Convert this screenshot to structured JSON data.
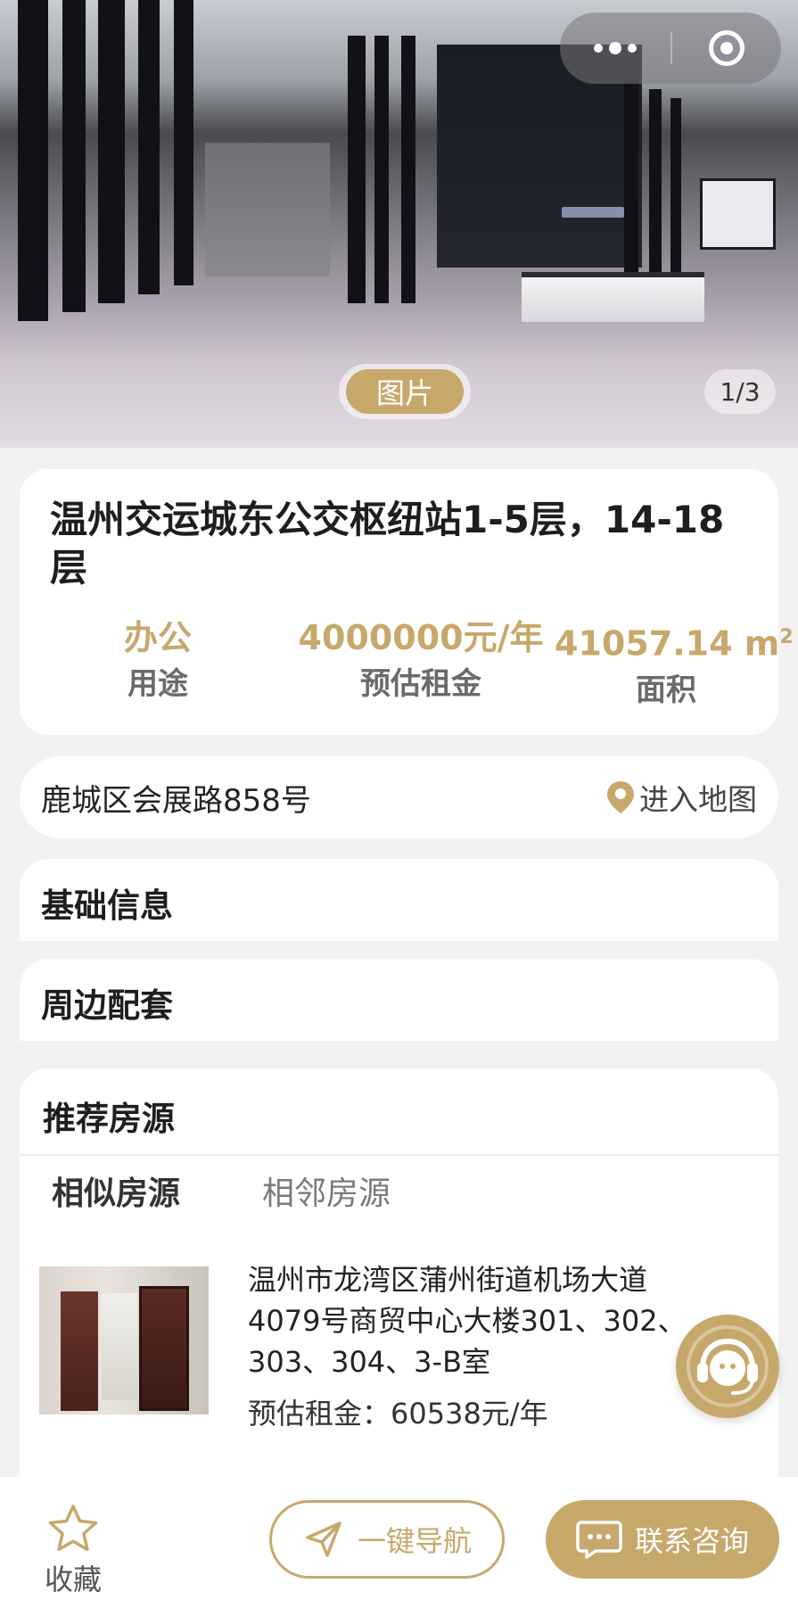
{
  "hero": {
    "badge_label": "图片",
    "counter": "1/3"
  },
  "property": {
    "title": "温州交运城东公交枢纽站1-5层，14-18层",
    "stats": {
      "usage_value": "办公",
      "usage_label": "用途",
      "rent_value": "4000000元/年",
      "rent_label": "预估租金",
      "area_value": "41057.14 m",
      "area_unit_sup": "2",
      "area_label": "面积"
    }
  },
  "address": {
    "text": "鹿城区会展路858号",
    "map_link": "进入地图"
  },
  "sections": {
    "basic_info": "基础信息",
    "surroundings": "周边配套",
    "recommended": "推荐房源"
  },
  "tabs": {
    "similar": "相似房源",
    "adjacent": "相邻房源"
  },
  "listing": {
    "title": "温州市龙湾区蒲州街道机场大道4079号商贸中心大楼301、302、303、304、3-B室",
    "price": "预估租金：60538元/年"
  },
  "bottom_bar": {
    "favorite_label": "收藏",
    "navigate_label": "一键导航",
    "consult_label": "联系咨询"
  },
  "colors": {
    "accent": "#c7a86b",
    "background": "#f2f2f2"
  }
}
